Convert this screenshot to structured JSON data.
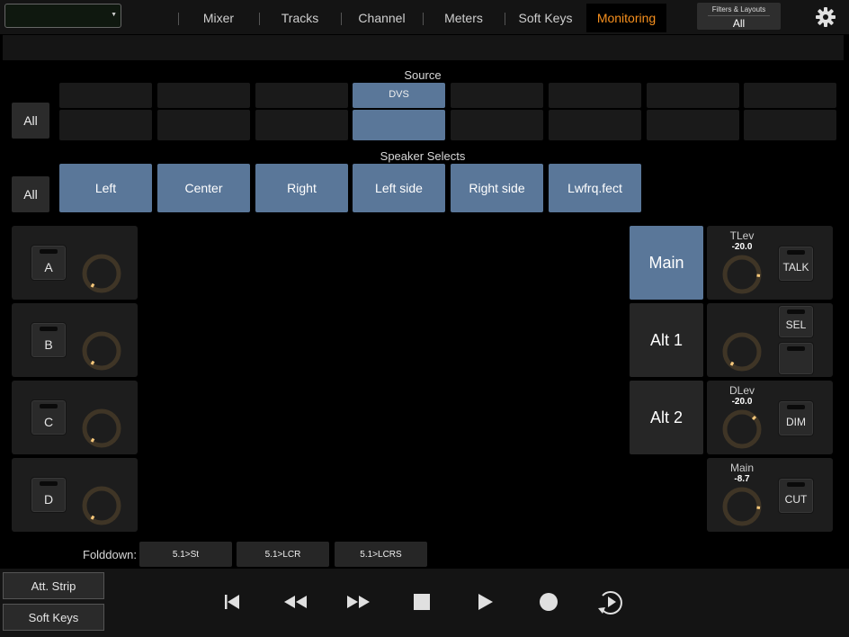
{
  "header": {
    "project_select_value": "",
    "tabs": [
      {
        "label": "Mixer",
        "active": false
      },
      {
        "label": "Tracks",
        "active": false
      },
      {
        "label": "Channel",
        "active": false
      },
      {
        "label": "Meters",
        "active": false
      },
      {
        "label": "Soft Keys",
        "active": false
      },
      {
        "label": "Monitoring",
        "active": true
      }
    ],
    "filters_title": "Filters & Layouts",
    "filters_value": "All",
    "settings_icon": "gear-icon"
  },
  "source": {
    "title": "Source",
    "all_label": "All",
    "selected_column": 3,
    "selected_label": "DVS"
  },
  "speaker_selects": {
    "title": "Speaker Selects",
    "all_label": "All",
    "items": [
      "Left",
      "Center",
      "Right",
      "Left side",
      "Right side",
      "Lwfrq.fect"
    ]
  },
  "inputs": [
    {
      "label": "A"
    },
    {
      "label": "B"
    },
    {
      "label": "C"
    },
    {
      "label": "D"
    }
  ],
  "monitor_outputs": [
    {
      "label": "Main",
      "selected": true
    },
    {
      "label": "Alt 1",
      "selected": false
    },
    {
      "label": "Alt 2",
      "selected": false
    }
  ],
  "controls": {
    "talk": {
      "title": "TLev",
      "value": "-20.0",
      "button": "TALK"
    },
    "sel": {
      "button": "SEL"
    },
    "dim": {
      "title": "DLev",
      "value": "-20.0",
      "button": "DIM"
    },
    "cut": {
      "title": "Main",
      "value": "-8.7",
      "button": "CUT"
    }
  },
  "folddown": {
    "label": "Folddown:",
    "options": [
      "5.1>St",
      "5.1>LCR",
      "5.1>LCRS"
    ]
  },
  "footer": {
    "att_strip": "Att. Strip",
    "soft_keys": "Soft Keys",
    "transport_icons": [
      "go-to-start-icon",
      "rewind-icon",
      "fast-forward-icon",
      "stop-icon",
      "play-icon",
      "record-icon",
      "loop-play-icon"
    ]
  },
  "colors": {
    "accent_orange": "#f7901e",
    "selected_blue": "#5a7799",
    "knob_indicator": "#f5c77a"
  }
}
